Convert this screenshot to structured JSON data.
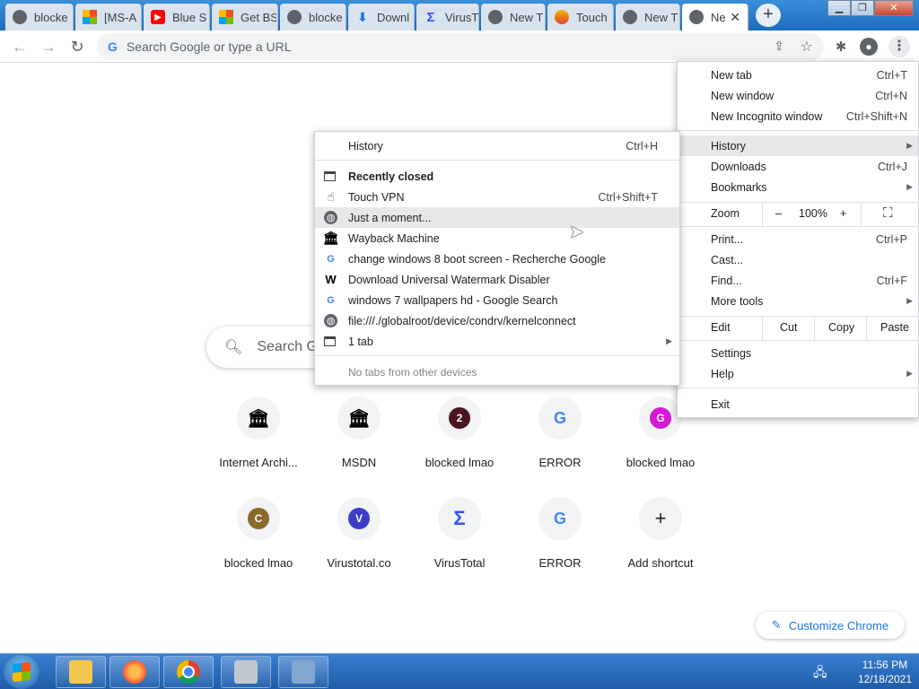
{
  "tabs": [
    {
      "title": "blocke",
      "icon": "chrome-globe-icon"
    },
    {
      "title": "[MS-A",
      "icon": "microsoft-icon"
    },
    {
      "title": "Blue S",
      "icon": "youtube-icon"
    },
    {
      "title": "Get BS",
      "icon": "microsoft-icon"
    },
    {
      "title": "blocke",
      "icon": "chrome-globe-icon"
    },
    {
      "title": "Downl",
      "icon": "download-icon"
    },
    {
      "title": "VirusT",
      "icon": "virustotal-icon"
    },
    {
      "title": "New T",
      "icon": "chrome-icon"
    },
    {
      "title": "Touch",
      "icon": "touch-vpn-icon"
    },
    {
      "title": "New T",
      "icon": "chrome-icon"
    },
    {
      "title": "Ne",
      "icon": "chrome-icon"
    }
  ],
  "toolbar": {
    "omnibox_placeholder": "Search Google or type a URL"
  },
  "ntp": {
    "search_placeholder": "Search Go",
    "shortcuts": [
      {
        "label": "Internet Archi...",
        "icon": "archive-icon",
        "letter": "",
        "color": ""
      },
      {
        "label": "MSDN",
        "icon": "archive-icon",
        "letter": "",
        "color": ""
      },
      {
        "label": "blocked lmao",
        "icon": "letter-icon",
        "letter": "2",
        "color": "#4a1520"
      },
      {
        "label": "ERROR",
        "icon": "google-icon",
        "letter": "G",
        "color": ""
      },
      {
        "label": "blocked lmao",
        "icon": "letter-icon",
        "letter": "G",
        "color": "#d61ad6"
      },
      {
        "label": "blocked lmao",
        "icon": "letter-icon",
        "letter": "C",
        "color": "#8a6a2a"
      },
      {
        "label": "Virustotal.co",
        "icon": "letter-icon",
        "letter": "V",
        "color": "#3c3cc8"
      },
      {
        "label": "VirusTotal",
        "icon": "virustotal-icon",
        "letter": "Σ",
        "color": ""
      },
      {
        "label": "ERROR",
        "icon": "google-icon",
        "letter": "G",
        "color": ""
      },
      {
        "label": "Add shortcut",
        "icon": "plus-icon",
        "letter": "+",
        "color": ""
      }
    ],
    "customize_label": "Customize Chrome"
  },
  "main_menu": {
    "new_tab": {
      "label": "New tab",
      "shortcut": "Ctrl+T"
    },
    "new_window": {
      "label": "New window",
      "shortcut": "Ctrl+N"
    },
    "incognito": {
      "label": "New Incognito window",
      "shortcut": "Ctrl+Shift+N"
    },
    "history": {
      "label": "History"
    },
    "downloads": {
      "label": "Downloads",
      "shortcut": "Ctrl+J"
    },
    "bookmarks": {
      "label": "Bookmarks"
    },
    "zoom": {
      "label": "Zoom",
      "minus": "–",
      "level": "100%",
      "plus": "+"
    },
    "print": {
      "label": "Print...",
      "shortcut": "Ctrl+P"
    },
    "cast": {
      "label": "Cast..."
    },
    "find": {
      "label": "Find...",
      "shortcut": "Ctrl+F"
    },
    "more_tools": {
      "label": "More tools"
    },
    "edit": {
      "label": "Edit",
      "cut": "Cut",
      "copy": "Copy",
      "paste": "Paste"
    },
    "settings": {
      "label": "Settings"
    },
    "help": {
      "label": "Help"
    },
    "exit": {
      "label": "Exit"
    }
  },
  "history_menu": {
    "history": {
      "label": "History",
      "shortcut": "Ctrl+H"
    },
    "recently_closed": "Recently closed",
    "items": [
      {
        "label": "Touch VPN",
        "shortcut": "Ctrl+Shift+T",
        "icon": "cursor-icon"
      },
      {
        "label": "Just a moment...",
        "shortcut": "",
        "icon": "globe-icon"
      },
      {
        "label": "Wayback Machine",
        "shortcut": "",
        "icon": "archive-icon"
      },
      {
        "label": "change windows 8 boot screen - Recherche Google",
        "shortcut": "",
        "icon": "google-icon"
      },
      {
        "label": "Download Universal Watermark Disabler",
        "shortcut": "",
        "icon": "w-icon"
      },
      {
        "label": "windows 7 wallpapers hd - Google Search",
        "shortcut": "",
        "icon": "google-icon"
      },
      {
        "label": "file:///./globalroot/device/condrv/kernelconnect",
        "shortcut": "",
        "icon": "globe-icon"
      }
    ],
    "one_tab": "1 tab",
    "no_tabs": "No tabs from other devices"
  },
  "taskbar": {
    "apps": [
      "explorer-icon",
      "firefox-icon",
      "chrome-icon",
      "installer-icon",
      "control-panel-icon"
    ],
    "time": "11:56 PM",
    "date": "12/18/2021"
  }
}
